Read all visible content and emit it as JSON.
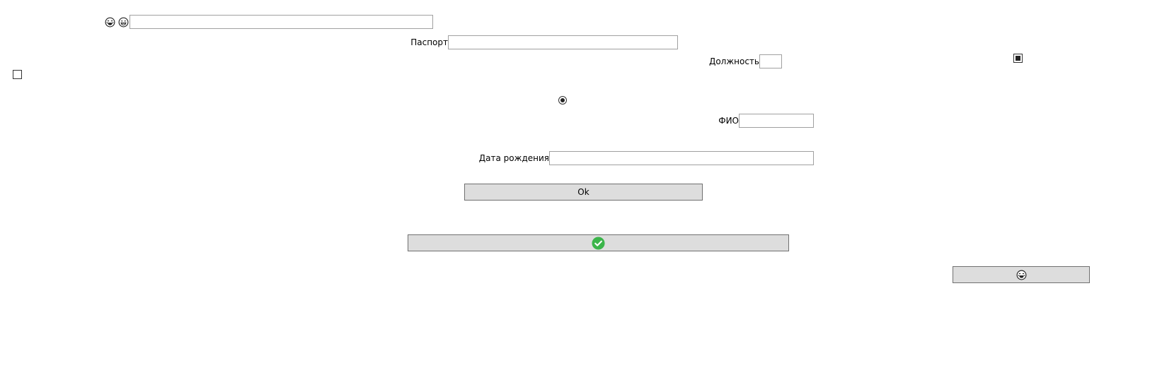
{
  "form": {
    "search_value": "",
    "passport_label": "Паспорт",
    "passport_value": "",
    "position_label": "Должность",
    "position_value": "",
    "fio_label": "ФИО",
    "fio_value": "",
    "birthdate_label": "Дата рождения",
    "birthdate_value": "",
    "ok_button_label": "Ok"
  },
  "checkboxes": {
    "left_checked": false,
    "right_indeterminate": true
  },
  "radio": {
    "checked": true
  },
  "icons": {
    "top_left_first": "laughing-face-icon",
    "top_left_second": "grinning-face-icon",
    "confirm_button": "green-checkmark-icon",
    "bottom_right_button": "laughing-face-icon"
  },
  "colors": {
    "button_background": "#dddddd",
    "input_border": "#a0a0a0",
    "check_green": "#3bb54a"
  }
}
